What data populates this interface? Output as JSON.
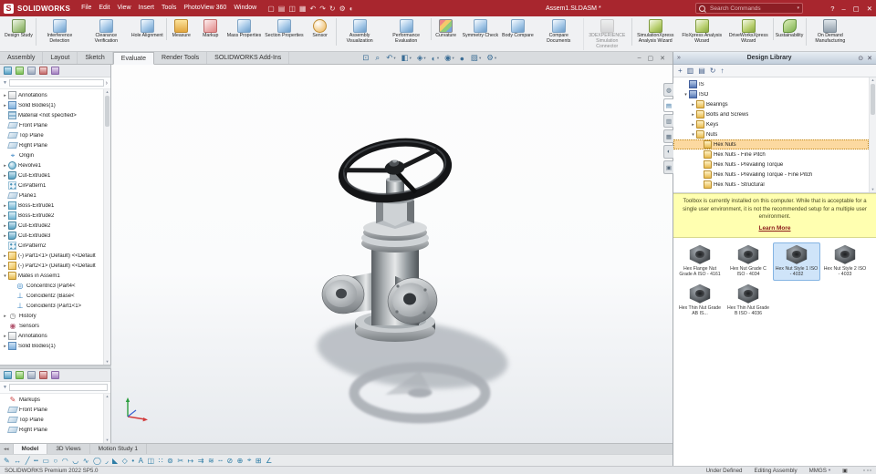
{
  "palette": {
    "titlebar_red": "#a8262e",
    "selection_orange": "#fcd9a0",
    "selection_blue": "#cfe4f9",
    "notice_yellow": "#ffffb0",
    "link_red": "#8b1a1a",
    "accent_blue": "#3c6e96"
  },
  "glyphs": {
    "caret": "▾",
    "chevron_right": "»",
    "pane_chevron": "›",
    "pin": "⊙",
    "close": "✕",
    "scroll_up": "▴",
    "scroll_down": "▾",
    "tab_nav": "◂◂",
    "funnel": "▼"
  },
  "titlebar": {
    "logo_text": "SOLIDWORKS",
    "logo_letter": "S",
    "document_title": "Assem1.SLDASM *",
    "search_placeholder": "Search Commands",
    "help_label": "?",
    "menus": [
      {
        "label": "File"
      },
      {
        "label": "Edit"
      },
      {
        "label": "View"
      },
      {
        "label": "Insert"
      },
      {
        "label": "Tools"
      },
      {
        "label": "PhotoView 360"
      },
      {
        "label": "Window"
      }
    ],
    "quick_access": [
      {
        "name": "new-document-icon",
        "glyph": "▢"
      },
      {
        "name": "open-icon",
        "glyph": "▤"
      },
      {
        "name": "save-icon",
        "glyph": "◫"
      },
      {
        "name": "print-icon",
        "glyph": "▦"
      },
      {
        "name": "undo-icon",
        "glyph": "↶"
      },
      {
        "name": "redo-icon",
        "glyph": "↷"
      },
      {
        "name": "rebuild-icon",
        "glyph": "↻"
      },
      {
        "name": "options-icon",
        "glyph": "⚙"
      },
      {
        "name": "edit-appearance-icon",
        "glyph": "◐"
      }
    ],
    "window_controls": [
      {
        "name": "minimize-icon",
        "glyph": "–"
      },
      {
        "name": "restore-icon",
        "glyph": "▢"
      },
      {
        "name": "close-icon",
        "glyph": "✕"
      }
    ]
  },
  "ribbon": {
    "items": [
      {
        "label": "Design Study",
        "icon": "design-study-icon"
      },
      {
        "label": "Interference Detection",
        "icon": "interference-detection-icon",
        "sep": true
      },
      {
        "label": "Clearance Verification",
        "icon": "clearance-verification-icon"
      },
      {
        "label": "Hole Alignment",
        "icon": "hole-alignment-icon"
      },
      {
        "label": "Measure",
        "icon": "measure-icon",
        "sep": true
      },
      {
        "label": "Markup",
        "icon": "markup-icon"
      },
      {
        "label": "Mass Properties",
        "icon": "mass-properties-icon"
      },
      {
        "label": "Section Properties",
        "icon": "section-properties-icon"
      },
      {
        "label": "Sensor",
        "icon": "sensor-icon"
      },
      {
        "label": "Assembly Visualization",
        "icon": "assembly-visualization-icon",
        "sep": true
      },
      {
        "label": "Performance Evaluation",
        "icon": "performance-evaluation-icon"
      },
      {
        "label": "Curvature",
        "icon": "curvature-icon",
        "sep": true
      },
      {
        "label": "Symmetry Check",
        "icon": "symmetry-check-icon"
      },
      {
        "label": "Body Compare",
        "icon": "body-compare-icon"
      },
      {
        "label": "Compare Documents",
        "icon": "compare-documents-icon"
      },
      {
        "label": "3DEXPERIENCE Simulation Connector",
        "icon": "simulation-connector-icon",
        "state": "disabled",
        "sep": true
      },
      {
        "label": "SimulationXpress Analysis Wizard",
        "icon": "simulationxpress-icon",
        "sep": true
      },
      {
        "label": "FloXpress Analysis Wizard",
        "icon": "floxpress-icon"
      },
      {
        "label": "DriveWorksXpress Wizard",
        "icon": "driveworksxpress-icon"
      },
      {
        "label": "Sustainability",
        "icon": "sustainability-icon",
        "sep": true
      },
      {
        "label": "On Demand Manufacturing",
        "icon": "on-demand-manufacturing-icon",
        "sep": true
      }
    ]
  },
  "command_tabs": [
    {
      "label": "Assembly"
    },
    {
      "label": "Layout"
    },
    {
      "label": "Sketch"
    },
    {
      "label": "Evaluate",
      "state": "active"
    },
    {
      "label": "Render Tools"
    },
    {
      "label": "SOLIDWORKS Add-Ins"
    }
  ],
  "viewport": {
    "hud": [
      {
        "name": "zoom-to-fit-icon",
        "glyph": "⊡",
        "caret": ""
      },
      {
        "name": "zoom-to-area-icon",
        "glyph": "⌕",
        "caret": ""
      },
      {
        "name": "previous-view-icon",
        "glyph": "↶",
        "caret": "▾"
      },
      {
        "name": "section-view-icon",
        "glyph": "◧",
        "caret": "▾"
      },
      {
        "name": "view-orientation-icon",
        "glyph": "◈",
        "caret": "▾"
      },
      {
        "name": "display-style-icon",
        "glyph": "◐",
        "caret": "▾"
      },
      {
        "name": "hide-show-items-icon",
        "glyph": "◉",
        "caret": "▾"
      },
      {
        "name": "edit-appearance-icon",
        "glyph": "●",
        "caret": ""
      },
      {
        "name": "apply-scene-icon",
        "glyph": "▨",
        "caret": "▾"
      },
      {
        "name": "view-settings-icon",
        "glyph": "⚙",
        "caret": "▾"
      }
    ],
    "window_controls": [
      {
        "name": "viewport-minimize-icon",
        "glyph": "–"
      },
      {
        "name": "viewport-restore-icon",
        "glyph": "▢"
      },
      {
        "name": "viewport-close-icon",
        "glyph": "✕"
      }
    ]
  },
  "left_panel": {
    "panel_tabs": [
      {
        "name": "featuremanager-tab-icon"
      },
      {
        "name": "propertymanager-tab-icon"
      },
      {
        "name": "configurationmanager-tab-icon"
      },
      {
        "name": "dimxpertmanager-tab-icon"
      },
      {
        "name": "displaymanager-tab-icon"
      }
    ],
    "feature_tree": [
      {
        "exp": "▸",
        "icon": "annotations-icon",
        "label": "Annotations"
      },
      {
        "exp": "▸",
        "icon": "solid-bodies-icon",
        "label": "Solid Bodies(1)"
      },
      {
        "exp": "",
        "icon": "material-icon",
        "label": "Material <not specified>"
      },
      {
        "exp": "",
        "icon": "plane-icon",
        "label": "Front Plane"
      },
      {
        "exp": "",
        "icon": "plane-icon",
        "label": "Top Plane"
      },
      {
        "exp": "",
        "icon": "plane-icon",
        "label": "Right Plane"
      },
      {
        "exp": "",
        "icon": "origin-icon",
        "glyph": "⌖",
        "label": "Origin"
      },
      {
        "exp": "▸",
        "icon": "revolve-icon",
        "label": "Revolve1"
      },
      {
        "exp": "▸",
        "icon": "cut-extrude-icon",
        "label": "Cut-Extrude1"
      },
      {
        "exp": "",
        "icon": "circular-pattern-icon",
        "label": "CirPattern1"
      },
      {
        "exp": "",
        "icon": "plane-icon",
        "label": "Plane1"
      },
      {
        "exp": "▸",
        "icon": "boss-extrude-icon",
        "label": "Boss-Extrude1"
      },
      {
        "exp": "▸",
        "icon": "boss-extrude-icon",
        "label": "Boss-Extrude2"
      },
      {
        "exp": "▸",
        "icon": "cut-extrude-icon",
        "label": "Cut-Extrude2"
      },
      {
        "exp": "▸",
        "icon": "cut-extrude-icon",
        "label": "Cut-Extrude3"
      },
      {
        "exp": "",
        "icon": "circular-pattern-icon",
        "label": "CirPattern2"
      },
      {
        "exp": "▸",
        "icon": "part-icon",
        "label": "(-) Part1<1> (Default) <<Default"
      },
      {
        "exp": "▸",
        "icon": "part-icon",
        "label": "(-) Part2<1> (Default) <<Default"
      },
      {
        "exp": "▾",
        "icon": "mates-folder-icon",
        "label": "Mates in Assem1"
      },
      {
        "exp": "",
        "icon": "concentric-mate-icon",
        "glyph": "◎",
        "label": "Concentric3 (Part4<",
        "indent": 1
      },
      {
        "exp": "",
        "icon": "coincident-mate-icon",
        "glyph": "⊥",
        "label": "Coincident2 (Base<",
        "indent": 1
      },
      {
        "exp": "",
        "icon": "coincident-mate-icon",
        "glyph": "⊥",
        "label": "Coincident3 (Part1<1>",
        "indent": 1
      },
      {
        "exp": "▸",
        "icon": "history-icon",
        "glyph": "◷",
        "label": "History"
      },
      {
        "exp": "",
        "icon": "sensors-icon",
        "glyph": "◉",
        "label": "Sensors"
      },
      {
        "exp": "▸",
        "icon": "annotations-icon",
        "label": "Annotations"
      },
      {
        "exp": "▸",
        "icon": "solid-bodies-icon",
        "label": "Solid Bodies(1)"
      }
    ],
    "bottom_tree": [
      {
        "exp": "",
        "icon": "markups-icon",
        "glyph": "✎",
        "label": "Markups"
      },
      {
        "exp": "",
        "icon": "plane-icon",
        "label": "Front Plane"
      },
      {
        "exp": "",
        "icon": "plane-icon",
        "label": "Top Plane"
      },
      {
        "exp": "",
        "icon": "plane-icon",
        "label": "Right Plane"
      }
    ]
  },
  "task_pane": {
    "title": "Design Library",
    "tabs": [
      {
        "name": "3dexperience-tab-icon",
        "glyph": "◍"
      },
      {
        "name": "design-library-tab-icon",
        "glyph": "▤",
        "state": "active"
      },
      {
        "name": "file-explorer-tab-icon",
        "glyph": "▥"
      },
      {
        "name": "view-palette-tab-icon",
        "glyph": "▦"
      },
      {
        "name": "appearances-tab-icon",
        "glyph": "◐"
      },
      {
        "name": "custom-properties-tab-icon",
        "glyph": "▣"
      }
    ],
    "toolbar": [
      {
        "name": "add-to-library-icon",
        "glyph": "+"
      },
      {
        "name": "add-file-location-icon",
        "glyph": "▥"
      },
      {
        "name": "create-new-folder-icon",
        "glyph": "▤"
      },
      {
        "name": "refresh-icon",
        "glyph": "↻"
      },
      {
        "name": "move-up-icon",
        "glyph": "↑"
      }
    ],
    "tree": [
      {
        "exp": "",
        "icon": "standard-folder-icon",
        "label": "IS",
        "indent": 1
      },
      {
        "exp": "▾",
        "icon": "standard-folder-icon",
        "label": "ISO",
        "indent": 1
      },
      {
        "exp": "▸",
        "icon": "library-folder-icon",
        "label": "Bearings",
        "indent": 2
      },
      {
        "exp": "▸",
        "icon": "library-folder-icon",
        "label": "Bolts and Screws",
        "indent": 2
      },
      {
        "exp": "▸",
        "icon": "library-folder-icon",
        "label": "Keys",
        "indent": 2
      },
      {
        "exp": "▾",
        "icon": "library-folder-icon",
        "label": "Nuts",
        "indent": 2
      },
      {
        "exp": "",
        "icon": "parts-folder-icon",
        "label": "Hex Nuts",
        "indent": 3,
        "state": "selected"
      },
      {
        "exp": "",
        "icon": "parts-folder-icon",
        "label": "Hex Nuts - Fine Pitch",
        "indent": 3
      },
      {
        "exp": "",
        "icon": "parts-folder-icon",
        "label": "Hex Nuts - Prevailing Torque",
        "indent": 3
      },
      {
        "exp": "",
        "icon": "parts-folder-icon",
        "label": "Hex Nuts - Prevailing Torque - Fine Pitch",
        "indent": 3
      },
      {
        "exp": "",
        "icon": "parts-folder-icon",
        "label": "Hex Nuts - Structural",
        "indent": 3
      }
    ],
    "notice": {
      "text": "Toolbox is currently installed on this computer. While that is acceptable for a single user environment, it is not the recommended setup for a multiple user environment.",
      "link": "Learn More"
    },
    "thumbnails": [
      {
        "label": "Hex Flange Nut Grade A ISO - 4161"
      },
      {
        "label": "Hex Nut Grade C ISO - 4034"
      },
      {
        "label": "Hex Nut Style 1 ISO - 4032",
        "state": "selected"
      },
      {
        "label": "Hex Nut Style 2 ISO - 4033"
      },
      {
        "label": "Hex Thin Nut Grade AB IS..."
      },
      {
        "label": "Hex Thin Nut Grade B ISO - 4036"
      }
    ]
  },
  "model_tabs": [
    {
      "label": "Model",
      "state": "active"
    },
    {
      "label": "3D Views"
    },
    {
      "label": "Motion Study 1"
    }
  ],
  "bottom_toolbar": [
    {
      "name": "sketch-icon",
      "glyph": "✎"
    },
    {
      "name": "smart-dimension-icon",
      "glyph": "↔"
    },
    {
      "name": "line-icon",
      "glyph": "╱"
    },
    {
      "name": "centerline-icon",
      "glyph": "╍"
    },
    {
      "name": "corner-rectangle-icon",
      "glyph": "▭"
    },
    {
      "name": "circle-icon",
      "glyph": "○"
    },
    {
      "name": "centerpoint-arc-icon",
      "glyph": "◠"
    },
    {
      "name": "tangent-arc-icon",
      "glyph": "◡"
    },
    {
      "name": "spline-icon",
      "glyph": "∿"
    },
    {
      "name": "ellipse-icon",
      "glyph": "◯"
    },
    {
      "name": "sketch-fillet-icon",
      "glyph": "◞"
    },
    {
      "name": "sketch-chamfer-icon",
      "glyph": "◣"
    },
    {
      "name": "polygon-icon",
      "glyph": "◇"
    },
    {
      "name": "point-icon",
      "glyph": "•"
    },
    {
      "name": "text-icon",
      "glyph": "A"
    },
    {
      "name": "mirror-entities-icon",
      "glyph": "◫"
    },
    {
      "name": "linear-sketch-pattern-icon",
      "glyph": "∷"
    },
    {
      "name": "circular-sketch-pattern-icon",
      "glyph": "⊚"
    },
    {
      "name": "trim-entities-icon",
      "glyph": "✂"
    },
    {
      "name": "extend-entities-icon",
      "glyph": "↦"
    },
    {
      "name": "convert-entities-icon",
      "glyph": "⇉"
    },
    {
      "name": "offset-entities-icon",
      "glyph": "≋"
    },
    {
      "name": "construction-geometry-icon",
      "glyph": "╌"
    },
    {
      "name": "display-relations-icon",
      "glyph": "⊘"
    },
    {
      "name": "repair-sketch-icon",
      "glyph": "⊕"
    },
    {
      "name": "quick-snaps-icon",
      "glyph": "⌖"
    },
    {
      "name": "grid-system-icon",
      "glyph": "⊞"
    },
    {
      "name": "instant2d-icon",
      "glyph": "∠"
    }
  ],
  "statusbar": {
    "left": "SOLIDWORKS Premium 2022 SP5.0",
    "geometry_status": "Under Defined",
    "mode": "Editing Assembly",
    "units": "MMGS",
    "icons": [
      {
        "name": "custom-properties-tag-icon",
        "glyph": "▣"
      }
    ]
  }
}
